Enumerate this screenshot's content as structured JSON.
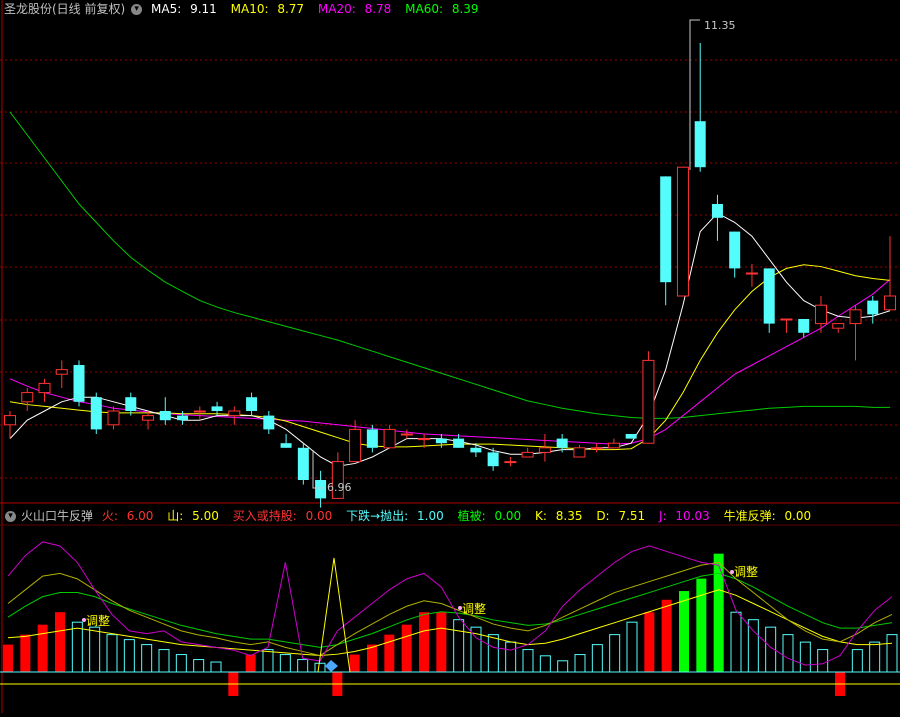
{
  "top_header": {
    "title": "圣龙股份(日线 前复权)",
    "ma5_label": "MA5:",
    "ma5": "9.11",
    "ma10_label": "MA10:",
    "ma10": "8.77",
    "ma20_label": "MA20:",
    "ma20": "8.78",
    "ma60_label": "MA60:",
    "ma60": "8.39"
  },
  "bottom_header": {
    "title": "火山口牛反弹",
    "fire_label": "火:",
    "fire": "6.00",
    "mountain_label": "山:",
    "mountain": "5.00",
    "buy_label": "买入或持股:",
    "buy": "0.00",
    "drop_label": "下跌→抛出:",
    "drop": "1.00",
    "plant_label": "植被:",
    "plant": "0.00",
    "k_label": "K:",
    "k": "8.35",
    "d_label": "D:",
    "d": "7.51",
    "j_label": "J:",
    "j": "10.03",
    "bull_label": "牛准反弹:",
    "bull": "0.00"
  },
  "colors": {
    "up": "#ff3333",
    "down": "#54fcfc",
    "ma5": "#ffffff",
    "ma10": "#ffff00",
    "ma20": "#ff00ff",
    "ma60": "#00cc00",
    "grid": "#9a0000",
    "bar_red": "#ff0000",
    "bar_cyan": "#54fcfc",
    "bar_green": "#00ff00"
  },
  "chart_data": [
    {
      "type": "candlestick",
      "title": "圣龙股份(日线 前复权)",
      "annotations": [
        "11.35",
        "6.96"
      ],
      "ylim": [
        6.6,
        11.6
      ],
      "candles": [
        {
          "o": 7.2,
          "h": 7.35,
          "l": 7.05,
          "c": 7.3
        },
        {
          "o": 7.45,
          "h": 7.6,
          "l": 7.35,
          "c": 7.55
        },
        {
          "o": 7.55,
          "h": 7.7,
          "l": 7.45,
          "c": 7.65
        },
        {
          "o": 7.75,
          "h": 7.9,
          "l": 7.6,
          "c": 7.8
        },
        {
          "o": 7.85,
          "h": 7.9,
          "l": 7.4,
          "c": 7.45
        },
        {
          "o": 7.5,
          "h": 7.55,
          "l": 7.1,
          "c": 7.15
        },
        {
          "o": 7.2,
          "h": 7.4,
          "l": 7.15,
          "c": 7.35
        },
        {
          "o": 7.5,
          "h": 7.55,
          "l": 7.3,
          "c": 7.35
        },
        {
          "o": 7.25,
          "h": 7.35,
          "l": 7.15,
          "c": 7.3
        },
        {
          "o": 7.35,
          "h": 7.5,
          "l": 7.2,
          "c": 7.25
        },
        {
          "o": 7.3,
          "h": 7.35,
          "l": 7.2,
          "c": 7.25
        },
        {
          "o": 7.35,
          "h": 7.4,
          "l": 7.25,
          "c": 7.35
        },
        {
          "o": 7.4,
          "h": 7.45,
          "l": 7.3,
          "c": 7.35
        },
        {
          "o": 7.3,
          "h": 7.4,
          "l": 7.2,
          "c": 7.35
        },
        {
          "o": 7.5,
          "h": 7.55,
          "l": 7.3,
          "c": 7.35
        },
        {
          "o": 7.3,
          "h": 7.35,
          "l": 7.1,
          "c": 7.15
        },
        {
          "o": 7.0,
          "h": 7.1,
          "l": 6.95,
          "c": 6.95
        },
        {
          "o": 6.95,
          "h": 7.0,
          "l": 6.55,
          "c": 6.6
        },
        {
          "o": 6.6,
          "h": 6.7,
          "l": 6.3,
          "c": 6.4
        },
        {
          "o": 6.4,
          "h": 6.9,
          "l": 6.4,
          "c": 6.8
        },
        {
          "o": 6.8,
          "h": 7.25,
          "l": 6.8,
          "c": 7.15
        },
        {
          "o": 7.15,
          "h": 7.2,
          "l": 6.9,
          "c": 6.95
        },
        {
          "o": 6.95,
          "h": 7.2,
          "l": 6.95,
          "c": 7.15
        },
        {
          "o": 7.1,
          "h": 7.15,
          "l": 7.05,
          "c": 7.1
        },
        {
          "o": 7.05,
          "h": 7.1,
          "l": 6.95,
          "c": 7.05
        },
        {
          "o": 7.05,
          "h": 7.1,
          "l": 6.95,
          "c": 7.0
        },
        {
          "o": 7.05,
          "h": 7.1,
          "l": 6.95,
          "c": 6.95
        },
        {
          "o": 6.95,
          "h": 7.0,
          "l": 6.85,
          "c": 6.9
        },
        {
          "o": 6.9,
          "h": 6.95,
          "l": 6.7,
          "c": 6.75
        },
        {
          "o": 6.8,
          "h": 6.85,
          "l": 6.75,
          "c": 6.8
        },
        {
          "o": 6.85,
          "h": 6.95,
          "l": 6.85,
          "c": 6.9
        },
        {
          "o": 6.9,
          "h": 7.1,
          "l": 6.8,
          "c": 6.95
        },
        {
          "o": 7.05,
          "h": 7.1,
          "l": 6.9,
          "c": 6.95
        },
        {
          "o": 6.85,
          "h": 6.98,
          "l": 6.85,
          "c": 6.95
        },
        {
          "o": 6.95,
          "h": 7.0,
          "l": 6.9,
          "c": 6.95
        },
        {
          "o": 6.95,
          "h": 7.05,
          "l": 6.95,
          "c": 7.0
        },
        {
          "o": 7.1,
          "h": 7.1,
          "l": 7.05,
          "c": 7.05
        },
        {
          "o": 7.0,
          "h": 8.0,
          "l": 7.0,
          "c": 7.9
        },
        {
          "o": 9.9,
          "h": 9.9,
          "l": 8.5,
          "c": 8.75
        },
        {
          "o": 8.6,
          "h": 10.0,
          "l": 8.6,
          "c": 10.0
        },
        {
          "o": 10.5,
          "h": 11.35,
          "l": 9.95,
          "c": 10.0
        },
        {
          "o": 9.6,
          "h": 9.7,
          "l": 9.2,
          "c": 9.45
        },
        {
          "o": 9.3,
          "h": 9.3,
          "l": 8.8,
          "c": 8.9
        },
        {
          "o": 8.85,
          "h": 8.95,
          "l": 8.7,
          "c": 8.85
        },
        {
          "o": 8.9,
          "h": 8.9,
          "l": 8.2,
          "c": 8.3
        },
        {
          "o": 8.35,
          "h": 8.35,
          "l": 8.2,
          "c": 8.35
        },
        {
          "o": 8.35,
          "h": 8.35,
          "l": 8.15,
          "c": 8.2
        },
        {
          "o": 8.3,
          "h": 8.6,
          "l": 8.2,
          "c": 8.5
        },
        {
          "o": 8.25,
          "h": 8.3,
          "l": 8.2,
          "c": 8.3
        },
        {
          "o": 8.3,
          "h": 8.5,
          "l": 7.9,
          "c": 8.45
        },
        {
          "o": 8.55,
          "h": 8.6,
          "l": 8.3,
          "c": 8.4
        },
        {
          "o": 8.45,
          "h": 9.25,
          "l": 8.45,
          "c": 8.6
        }
      ],
      "ma5": [
        7.05,
        7.25,
        7.35,
        7.45,
        7.5,
        7.5,
        7.45,
        7.4,
        7.35,
        7.3,
        7.25,
        7.25,
        7.3,
        7.3,
        7.3,
        7.25,
        7.15,
        7.0,
        6.85,
        6.75,
        6.78,
        6.85,
        6.95,
        7.05,
        7.05,
        7.05,
        7.02,
        6.98,
        6.92,
        6.88,
        6.88,
        6.9,
        6.93,
        6.93,
        6.95,
        6.95,
        7.0,
        7.3,
        7.8,
        8.5,
        9.3,
        9.5,
        9.4,
        9.25,
        9.0,
        8.75,
        8.55,
        8.45,
        8.38,
        8.36,
        8.38,
        8.44
      ],
      "ma10": [
        7.45,
        7.42,
        7.4,
        7.38,
        7.36,
        7.34,
        7.33,
        7.33,
        7.33,
        7.33,
        7.32,
        7.32,
        7.32,
        7.31,
        7.3,
        7.28,
        7.24,
        7.18,
        7.12,
        7.06,
        7.0,
        6.97,
        6.96,
        6.96,
        6.97,
        6.98,
        6.99,
        6.99,
        6.99,
        6.98,
        6.97,
        6.96,
        6.95,
        6.94,
        6.93,
        6.93,
        6.94,
        7.05,
        7.25,
        7.55,
        7.9,
        8.2,
        8.45,
        8.65,
        8.8,
        8.9,
        8.94,
        8.92,
        8.87,
        8.82,
        8.79,
        8.77
      ],
      "ma20": [
        7.7,
        7.62,
        7.55,
        7.5,
        7.45,
        7.42,
        7.38,
        7.36,
        7.34,
        7.32,
        7.31,
        7.3,
        7.29,
        7.28,
        7.27,
        7.26,
        7.25,
        7.24,
        7.22,
        7.2,
        7.18,
        7.16,
        7.14,
        7.12,
        7.1,
        7.09,
        7.08,
        7.07,
        7.06,
        7.05,
        7.04,
        7.03,
        7.02,
        7.01,
        7.0,
        6.99,
        7.0,
        7.05,
        7.15,
        7.3,
        7.45,
        7.6,
        7.75,
        7.85,
        7.95,
        8.05,
        8.15,
        8.25,
        8.38,
        8.5,
        8.62,
        8.78
      ],
      "ma60": [
        10.6,
        10.35,
        10.1,
        9.85,
        9.6,
        9.4,
        9.2,
        9.02,
        8.88,
        8.75,
        8.65,
        8.55,
        8.48,
        8.42,
        8.37,
        8.32,
        8.27,
        8.22,
        8.17,
        8.12,
        8.06,
        8.0,
        7.94,
        7.88,
        7.82,
        7.76,
        7.7,
        7.64,
        7.58,
        7.52,
        7.46,
        7.42,
        7.38,
        7.35,
        7.32,
        7.3,
        7.28,
        7.27,
        7.27,
        7.28,
        7.3,
        7.32,
        7.34,
        7.36,
        7.38,
        7.39,
        7.4,
        7.4,
        7.4,
        7.4,
        7.39,
        7.39
      ]
    },
    {
      "type": "bar",
      "title": "火山口牛反弹",
      "annotations": [
        "调整",
        "调整",
        "调整"
      ],
      "ylim": [
        -20,
        110
      ],
      "bars": [
        {
          "v": 22,
          "c": "r"
        },
        {
          "v": 30,
          "c": "r"
        },
        {
          "v": 38,
          "c": "r"
        },
        {
          "v": 48,
          "c": "r"
        },
        {
          "v": 40,
          "c": "c"
        },
        {
          "v": 36,
          "c": "c"
        },
        {
          "v": 30,
          "c": "c"
        },
        {
          "v": 26,
          "c": "c"
        },
        {
          "v": 22,
          "c": "c"
        },
        {
          "v": 18,
          "c": "c"
        },
        {
          "v": 14,
          "c": "c"
        },
        {
          "v": 10,
          "c": "c"
        },
        {
          "v": 8,
          "c": "c"
        },
        {
          "v": -14,
          "c": "r"
        },
        {
          "v": 14,
          "c": "r"
        },
        {
          "v": 18,
          "c": "c"
        },
        {
          "v": 14,
          "c": "c"
        },
        {
          "v": 10,
          "c": "c"
        },
        {
          "v": 7,
          "c": "c"
        },
        {
          "v": -14,
          "c": "r"
        },
        {
          "v": 14,
          "c": "r"
        },
        {
          "v": 22,
          "c": "r"
        },
        {
          "v": 30,
          "c": "r"
        },
        {
          "v": 38,
          "c": "r"
        },
        {
          "v": 48,
          "c": "r"
        },
        {
          "v": 48,
          "c": "r"
        },
        {
          "v": 42,
          "c": "c"
        },
        {
          "v": 36,
          "c": "c"
        },
        {
          "v": 30,
          "c": "c"
        },
        {
          "v": 24,
          "c": "c"
        },
        {
          "v": 18,
          "c": "c"
        },
        {
          "v": 13,
          "c": "c"
        },
        {
          "v": 9,
          "c": "c"
        },
        {
          "v": 14,
          "c": "c"
        },
        {
          "v": 22,
          "c": "c"
        },
        {
          "v": 30,
          "c": "c"
        },
        {
          "v": 40,
          "c": "c"
        },
        {
          "v": 48,
          "c": "r"
        },
        {
          "v": 58,
          "c": "r"
        },
        {
          "v": 65,
          "c": "g"
        },
        {
          "v": 75,
          "c": "g"
        },
        {
          "v": 95,
          "c": "g"
        },
        {
          "v": 48,
          "c": "c"
        },
        {
          "v": 42,
          "c": "c"
        },
        {
          "v": 36,
          "c": "c"
        },
        {
          "v": 30,
          "c": "c"
        },
        {
          "v": 24,
          "c": "c"
        },
        {
          "v": 18,
          "c": "c"
        },
        {
          "v": -14,
          "c": "r"
        },
        {
          "v": 18,
          "c": "c"
        },
        {
          "v": 24,
          "c": "c"
        },
        {
          "v": 30,
          "c": "c"
        }
      ],
      "k": [
        50,
        60,
        70,
        72,
        68,
        60,
        52,
        45,
        40,
        35,
        30,
        27,
        25,
        22,
        20,
        22,
        18,
        15,
        12,
        20,
        28,
        35,
        42,
        48,
        52,
        50,
        45,
        40,
        35,
        32,
        30,
        34,
        40,
        46,
        52,
        58,
        62,
        66,
        70,
        74,
        78,
        80,
        68,
        58,
        48,
        38,
        30,
        24,
        22,
        28,
        36,
        42
      ],
      "d": [
        40,
        48,
        55,
        58,
        58,
        55,
        50,
        46,
        42,
        38,
        34,
        31,
        28,
        26,
        24,
        24,
        22,
        20,
        18,
        20,
        24,
        28,
        33,
        38,
        42,
        44,
        43,
        41,
        38,
        36,
        34,
        35,
        38,
        42,
        46,
        50,
        54,
        58,
        62,
        66,
        70,
        72,
        68,
        62,
        55,
        48,
        42,
        36,
        32,
        32,
        34,
        36
      ],
      "j": [
        70,
        85,
        95,
        92,
        80,
        60,
        42,
        30,
        28,
        30,
        22,
        20,
        18,
        16,
        12,
        18,
        80,
        10,
        8,
        30,
        40,
        50,
        60,
        68,
        72,
        62,
        40,
        25,
        18,
        16,
        20,
        30,
        48,
        60,
        70,
        80,
        88,
        92,
        88,
        84,
        80,
        78,
        45,
        30,
        18,
        10,
        5,
        6,
        12,
        30,
        45,
        55
      ],
      "line_y": [
        25,
        26,
        28,
        30,
        32,
        30,
        28,
        26,
        24,
        22,
        20,
        19,
        18,
        17,
        16,
        15,
        14,
        13,
        12,
        13,
        15,
        18,
        22,
        26,
        30,
        32,
        30,
        28,
        25,
        22,
        20,
        21,
        24,
        28,
        32,
        36,
        40,
        44,
        48,
        52,
        56,
        60,
        56,
        50,
        44,
        38,
        32,
        26,
        22,
        20,
        20,
        21
      ]
    }
  ]
}
